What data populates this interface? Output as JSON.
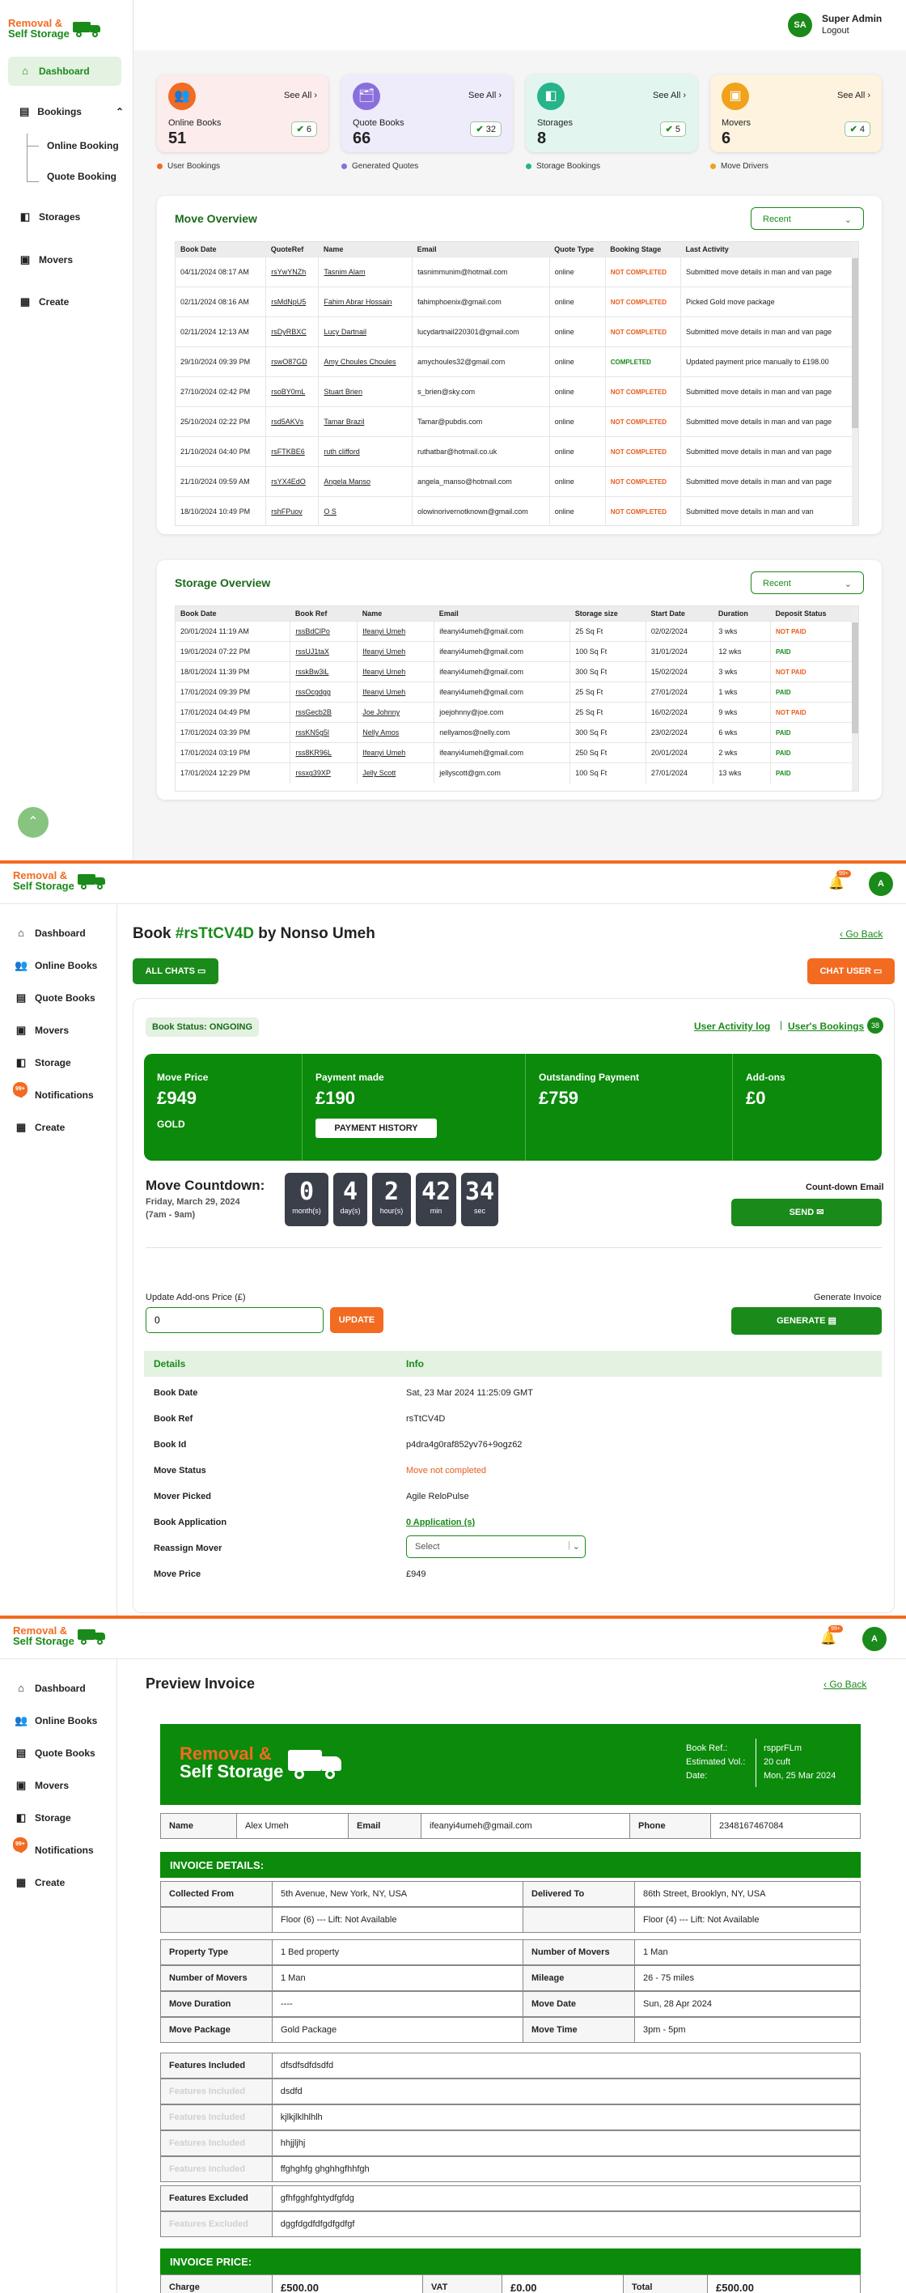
{
  "brand": {
    "line1": "Removal &",
    "line2": "Self Storage"
  },
  "dashboard": {
    "sidebar": {
      "dashboard": "Dashboard",
      "bookings": "Bookings",
      "online": "Online Booking",
      "quote": "Quote Booking",
      "storages": "Storages",
      "movers": "Movers",
      "create": "Create"
    },
    "user": {
      "initials": "SA",
      "name": "Super Admin",
      "logout": "Logout"
    },
    "cards": [
      {
        "label": "Online Books",
        "value": "51",
        "badge": "6",
        "see": "See All",
        "legend": "User Bookings",
        "color": "#f26b21",
        "bg": "#fdecec"
      },
      {
        "label": "Quote Books",
        "value": "66",
        "badge": "32",
        "see": "See All",
        "legend": "Generated Quotes",
        "color": "#8a6fdc",
        "bg": "#eeecfb"
      },
      {
        "label": "Storages",
        "value": "8",
        "badge": "5",
        "see": "See All",
        "legend": "Storage Bookings",
        "color": "#26b48a",
        "bg": "#e2f6ef"
      },
      {
        "label": "Movers",
        "value": "6",
        "badge": "4",
        "see": "See All",
        "legend": "Move Drivers",
        "color": "#f0a21b",
        "bg": "#fdf3df"
      }
    ],
    "move_overview": {
      "title": "Move Overview",
      "filter": "Recent",
      "headers": [
        "Book Date",
        "QuoteRef",
        "Name",
        "Email",
        "Quote Type",
        "Booking Stage",
        "Last Activity"
      ],
      "rows": [
        [
          "04/11/2024 08:17 AM",
          "rsYwYNZh",
          "Tasnim Alam",
          "tasnimmunim@hotmail.com",
          "online",
          "NOT COMPLETED",
          "Submitted move details in man and van page"
        ],
        [
          "02/11/2024 08:16 AM",
          "rsMdNpU5",
          "Fahim Abrar Hossain",
          "fahimphoenix@gmail.com",
          "online",
          "NOT COMPLETED",
          "Picked Gold move package"
        ],
        [
          "02/11/2024 12:13 AM",
          "rsDyRBXC",
          "Lucy Dartnail",
          "lucydartnail220301@gmail.com",
          "online",
          "NOT COMPLETED",
          "Submitted move details in man and van page"
        ],
        [
          "29/10/2024 09:39 PM",
          "rswO87GD",
          "Amy Choules Choules",
          "amychoules32@gmail.com",
          "online",
          "COMPLETED",
          "Updated payment price manually to £198.00"
        ],
        [
          "27/10/2024 02:42 PM",
          "rsoBY0mL",
          "Stuart Brien",
          "s_brien@sky.com",
          "online",
          "NOT COMPLETED",
          "Submitted move details in man and van page"
        ],
        [
          "25/10/2024 02:22 PM",
          "rsd5AKVs",
          "Tamar Brazil",
          "Tamar@pubdis.com",
          "online",
          "NOT COMPLETED",
          "Submitted move details in man and van page"
        ],
        [
          "21/10/2024 04:40 PM",
          "rsFTKBE6",
          "ruth clifford",
          "ruthatbar@hotmail.co.uk",
          "online",
          "NOT COMPLETED",
          "Submitted move details in man and van page"
        ],
        [
          "21/10/2024 09:59 AM",
          "rsYX4EdO",
          "Angela Manso",
          "angela_manso@hotmail.com",
          "online",
          "NOT COMPLETED",
          "Submitted move details in man and van page"
        ],
        [
          "18/10/2024 10:49 PM",
          "rshFPuov",
          "O S",
          "olowinorivernotknown@gmail.com",
          "online",
          "NOT COMPLETED",
          "Submitted move details in man and van"
        ]
      ]
    },
    "storage_overview": {
      "title": "Storage Overview",
      "filter": "Recent",
      "headers": [
        "Book Date",
        "Book Ref",
        "Name",
        "Email",
        "Storage size",
        "Start Date",
        "Duration",
        "Deposit Status"
      ],
      "rows": [
        [
          "20/01/2024 11:19 AM",
          "rssBdClPo",
          "Ifeanyi Umeh",
          "ifeanyi4umeh@gmail.com",
          "25 Sq Ft",
          "02/02/2024",
          "3 wks",
          "NOT PAID"
        ],
        [
          "19/01/2024 07:22 PM",
          "rssUJ1taX",
          "Ifeanyi Umeh",
          "ifeanyi4umeh@gmail.com",
          "100 Sq Ft",
          "31/01/2024",
          "12 wks",
          "PAID"
        ],
        [
          "18/01/2024 11:39 PM",
          "rsskBw3iL",
          "Ifeanyi Umeh",
          "ifeanyi4umeh@gmail.com",
          "300 Sq Ft",
          "15/02/2024",
          "3 wks",
          "NOT PAID"
        ],
        [
          "17/01/2024 09:39 PM",
          "rssOcgdgg",
          "Ifeanyi Umeh",
          "ifeanyi4umeh@gmail.com",
          "25 Sq Ft",
          "27/01/2024",
          "1 wks",
          "PAID"
        ],
        [
          "17/01/2024 04:49 PM",
          "rssGecb2B",
          "Joe Johnny",
          "joejohnny@joe.com",
          "25 Sq Ft",
          "16/02/2024",
          "9 wks",
          "NOT PAID"
        ],
        [
          "17/01/2024 03:39 PM",
          "rssKN5g5l",
          "Nelly Amos",
          "nellyamos@nelly.com",
          "300 Sq Ft",
          "23/02/2024",
          "6 wks",
          "PAID"
        ],
        [
          "17/01/2024 03:19 PM",
          "rss8KR96L",
          "Ifeanyi Umeh",
          "ifeanyi4umeh@gmail.com",
          "250 Sq Ft",
          "20/01/2024",
          "2 wks",
          "PAID"
        ],
        [
          "17/01/2024 12:29 PM",
          "rssxg39XP",
          "Jelly Scott",
          "jellyscott@gm.com",
          "100 Sq Ft",
          "27/01/2024",
          "13 wks",
          "PAID"
        ]
      ]
    }
  },
  "side2": {
    "dashboard": "Dashboard",
    "online": "Online Books",
    "quote": "Quote Books",
    "movers": "Movers",
    "storage": "Storage",
    "notifications": "Notifications",
    "notif_badge": "99+",
    "create": "Create"
  },
  "header2": {
    "bell_badge": "99+",
    "avatar": "A"
  },
  "book": {
    "title_pre": "Book ",
    "ref": "#rsTtCV4D",
    "title_post": " by Nonso Umeh",
    "back": "Go Back",
    "all_chats": "ALL CHATS",
    "chat_user": "CHAT USER",
    "status": "Book Status: ONGOING",
    "activity": "User Activity log",
    "bookings": "User's Bookings",
    "bookings_count": "38",
    "move_price_l": "Move Price",
    "move_price": "£949",
    "package": "GOLD",
    "paid_l": "Payment made",
    "paid": "£190",
    "history": "PAYMENT HISTORY",
    "outstanding_l": "Outstanding Payment",
    "outstanding": "£759",
    "addons_l": "Add-ons",
    "addons": "£0",
    "countdown_l": "Move Countdown:",
    "date": "Friday, March 29, 2024",
    "time": "(7am - 9am)",
    "countdown": [
      {
        "n": "0",
        "u": "month(s)"
      },
      {
        "n": "4",
        "u": "day(s)"
      },
      {
        "n": "2",
        "u": "hour(s)"
      },
      {
        "n": "42",
        "u": "min"
      },
      {
        "n": "34",
        "u": "sec"
      }
    ],
    "email_l": "Count-down Email",
    "send": "SEND",
    "addon_l": "Update Add-ons Price (£)",
    "addon_val": "0",
    "update": "UPDATE",
    "invoice_l": "Generate Invoice",
    "generate": "GENERATE",
    "details_h": "Details",
    "info_h": "Info",
    "details": [
      [
        "Book Date",
        "Sat, 23 Mar 2024 11:25:09 GMT"
      ],
      [
        "Book Ref",
        "rsTtCV4D"
      ],
      [
        "Book Id",
        "p4dra4g0raf852yv76+9ogz62"
      ],
      [
        "Move Status",
        "Move not completed"
      ],
      [
        "Mover Picked",
        "Agile ReloPulse"
      ],
      [
        "Book Application",
        "0 Application (s)"
      ],
      [
        "Reassign Mover",
        ""
      ],
      [
        "Move Price",
        "£949"
      ]
    ],
    "select": "Select"
  },
  "invoice": {
    "title": "Preview Invoice",
    "back": "Go Back",
    "ref_l": "Book Ref.:",
    "ref": "rspprFLm",
    "vol_l": "Estimated Vol.:",
    "vol": "20 cuft",
    "date_l": "Date:",
    "date": "Mon, 25 Mar 2024",
    "name_l": "Name",
    "name": "Alex Umeh",
    "email_l": "Email",
    "email": "ifeanyi4umeh@gmail.com",
    "phone_l": "Phone",
    "phone": "2348167467084",
    "details_h": "INVOICE DETAILS:",
    "from_l": "Collected From",
    "from": "5th Avenue, New York, NY, USA",
    "to_l": "Delivered To",
    "to": "86th Street, Brooklyn, NY, USA",
    "floor_from": "Floor (6) --- Lift: Not Available",
    "floor_to": "Floor (4) --- Lift: Not Available",
    "ptype_l": "Property Type",
    "ptype": "1 Bed property",
    "movers_l": "Number of Movers",
    "movers": "1 Man",
    "movers2_l": "Number of Movers",
    "movers2": "1 Man",
    "mileage_l": "Mileage",
    "mileage": "26 - 75 miles",
    "dur_l": "Move Duration",
    "dur": "----",
    "mdate_l": "Move Date",
    "mdate": "Sun, 28 Apr 2024",
    "pkg_l": "Move Package",
    "pkg": "Gold Package",
    "mtime_l": "Move Time",
    "mtime": "3pm - 5pm",
    "inc_l": "Features Included",
    "inc": [
      "dfsdfsdfdsdfd",
      "dsdfd",
      "kjlkjlklhlhlh",
      "hhjjljhj",
      "ffghghfg ghghhgfhhfgh"
    ],
    "exc_l": "Features Excluded",
    "exc": [
      "gfhfgghfghtydfgfdg",
      "dggfdgdfdfgdfgdfgf"
    ],
    "price_h": "INVOICE PRICE:",
    "charge_l": "Charge",
    "charge": "£500.00",
    "vat_l": "VAT",
    "vat": "£0.00",
    "total_l": "Total",
    "total": "£500.00"
  }
}
